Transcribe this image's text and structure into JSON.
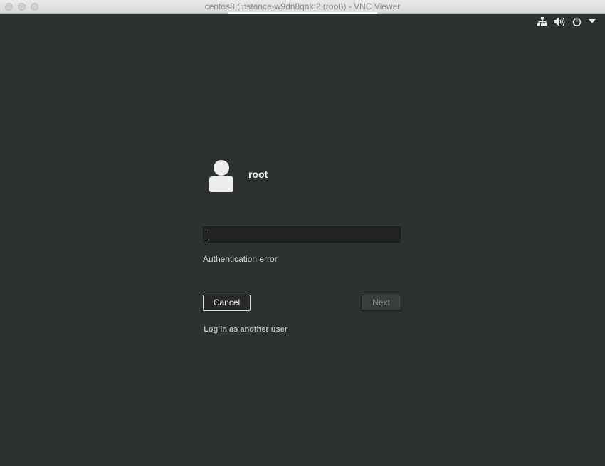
{
  "window": {
    "title": "centos8 (instance-w9dn8qnk:2 (root)) - VNC Viewer"
  },
  "top_bar": {
    "icons": [
      "network-icon",
      "volume-icon",
      "power-icon",
      "chevron-down-icon"
    ]
  },
  "login": {
    "username": "root",
    "password_value": "",
    "message": "Authentication error",
    "cancel_label": "Cancel",
    "next_label": "Next",
    "alt_user_label": "Log in as another user"
  },
  "colors": {
    "background": "#2e3132",
    "text": "#eeeeec",
    "muted_text": "#babdb6"
  }
}
